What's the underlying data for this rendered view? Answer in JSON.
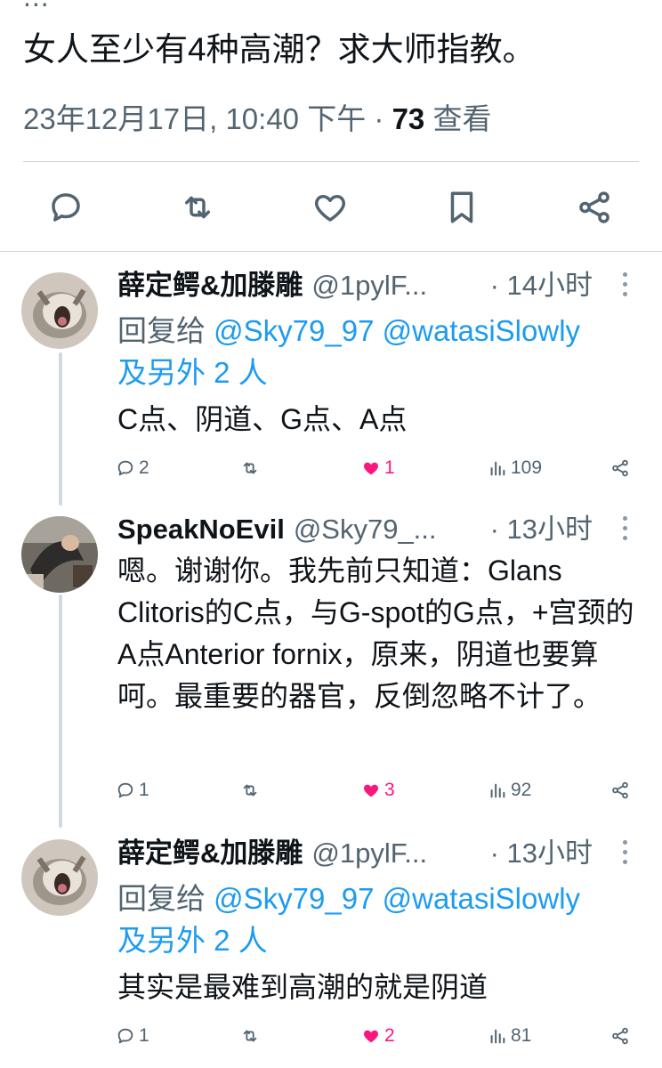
{
  "top_partial": "...",
  "post": {
    "text": "女人至少有4种高潮？求大师指教。",
    "timestamp": "23年12月17日, 10:40 下午",
    "separator": "·",
    "views_count": "73",
    "views_label": "查看"
  },
  "icons": {
    "reply": "reply-icon",
    "retweet": "retweet-icon",
    "like": "heart-icon",
    "bookmark": "bookmark-icon",
    "share": "share-icon",
    "views": "views-chart-icon",
    "more": "more-vertical-icon"
  },
  "colors": {
    "accent": "#1d9bf0",
    "like": "#f91880",
    "secondary": "#536471"
  },
  "replies": [
    {
      "name": "薛定鳄&加滕雕",
      "handle": "@1pylF...",
      "time": "· 14小时",
      "replying_label": "回复给",
      "mention1": "@Sky79_97",
      "mention2": "@watasiSlowly",
      "others": "及另外 2 人",
      "text": "C点、阴道、G点、A点",
      "replies": "2",
      "retweets": "",
      "likes": "1",
      "views": "109"
    },
    {
      "name": "SpeakNoEvil",
      "handle": "@Sky79_...",
      "time": "· 13小时",
      "text": "嗯。谢谢你。我先前只知道：Glans Clitoris的C点，与G-spot的G点，+宫颈的A点Anterior fornix，原来，阴道也要算呵。最重要的器官，反倒忽略不计了。",
      "replies": "1",
      "retweets": "",
      "likes": "3",
      "views": "92"
    },
    {
      "name": "薛定鳄&加滕雕",
      "handle": "@1pylF...",
      "time": "· 13小时",
      "replying_label": "回复给",
      "mention1": "@Sky79_97",
      "mention2": "@watasiSlowly",
      "others": "及另外 2 人",
      "text": "其实是最难到高潮的就是阴道",
      "replies": "1",
      "retweets": "",
      "likes": "2",
      "views": "81"
    }
  ]
}
